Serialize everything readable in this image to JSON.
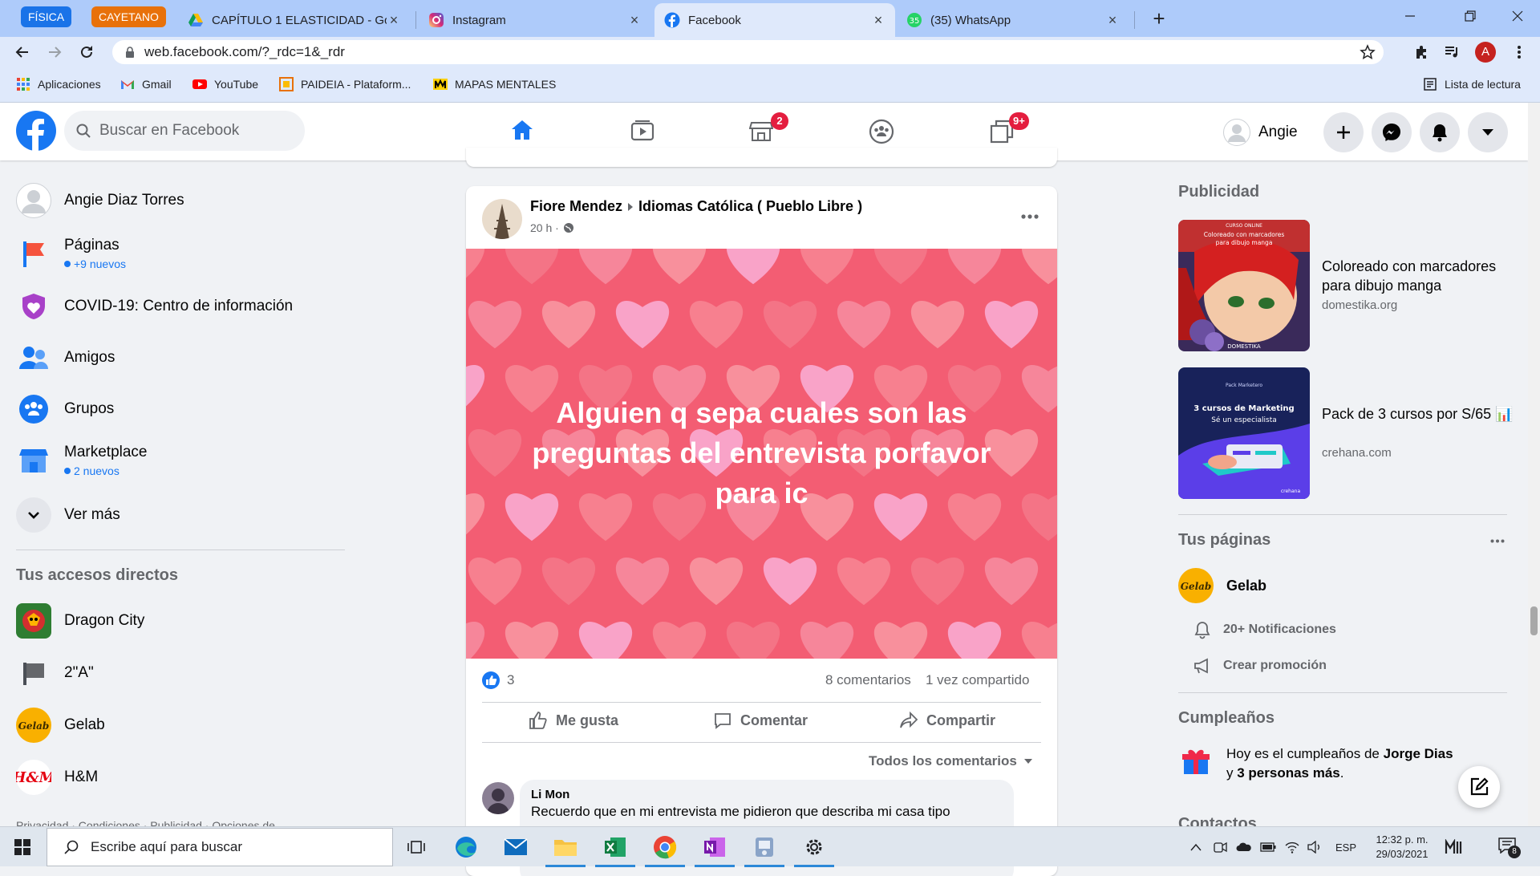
{
  "browser": {
    "tab_groups": [
      {
        "label": "FÍSICA",
        "color": "#1a73e8"
      },
      {
        "label": "CAYETANO",
        "color": "#e8710a"
      }
    ],
    "tabs": [
      {
        "title": "CAPÍTULO 1 ELASTICIDAD - Goo",
        "icon": "google-drive-icon",
        "active": false
      },
      {
        "title": "Instagram",
        "icon": "instagram-icon",
        "active": false
      },
      {
        "title": "Facebook",
        "icon": "facebook-icon",
        "active": true
      },
      {
        "title": "(35) WhatsApp",
        "icon": "whatsapp-icon",
        "active": false
      }
    ],
    "new_tab": "+",
    "url": "web.facebook.com/?_rdc=1&_rdr",
    "profile_initial": "A",
    "bookmarks": [
      {
        "label": "Aplicaciones",
        "icon": "apps-grid-icon"
      },
      {
        "label": "Gmail",
        "icon": "gmail-icon"
      },
      {
        "label": "YouTube",
        "icon": "youtube-icon"
      },
      {
        "label": "PAIDEIA - Plataform...",
        "icon": "paideia-icon"
      },
      {
        "label": "MAPAS MENTALES",
        "icon": "mapas-icon"
      }
    ],
    "reading_list": "Lista de lectura"
  },
  "fb": {
    "brand_color": "#1877f2",
    "search_placeholder": "Buscar en Facebook",
    "nav_badges": {
      "marketplace": "2",
      "gaming": "9+"
    },
    "profile_name": "Angie",
    "left_menu": [
      {
        "label": "Angie Diaz Torres",
        "icon": "avatar-icon"
      },
      {
        "label": "Páginas",
        "sub": "+9 nuevos",
        "icon": "pages-flag-icon"
      },
      {
        "label": "COVID-19: Centro de información",
        "icon": "covid-heart-icon"
      },
      {
        "label": "Amigos",
        "icon": "friends-icon"
      },
      {
        "label": "Grupos",
        "icon": "groups-icon"
      },
      {
        "label": "Marketplace",
        "sub": "2 nuevos",
        "icon": "marketplace-icon"
      },
      {
        "label": "Ver más",
        "icon": "chevron-down-icon"
      }
    ],
    "shortcuts_title": "Tus accesos directos",
    "shortcuts": [
      {
        "label": "Dragon City",
        "icon": "dragon-city-icon"
      },
      {
        "label": "2\"A\"",
        "icon": "flag-icon"
      },
      {
        "label": "Gelab",
        "icon": "gelab-icon"
      },
      {
        "label": "H&M",
        "icon": "hm-icon"
      }
    ],
    "footer_links": "Privacidad · Condiciones · Publicidad · Opciones de",
    "post": {
      "author": "Fiore Mendez",
      "group": "Idiomas Católica ( Pueblo Libre )",
      "time": "20 h ·",
      "text": "Alguien q sepa cuales son las preguntas del entrevista porfavor para ic",
      "likes": "3",
      "comments": "8 comentarios",
      "shares": "1 vez compartido",
      "actions": {
        "like": "Me gusta",
        "comment": "Comentar",
        "share": "Compartir"
      },
      "comment_filter": "Todos los comentarios",
      "first_comment": {
        "author": "Li Mon",
        "text": "Recuerdo que en mi entrevista me pidieron que describa mi casa tipo"
      }
    },
    "right": {
      "ads_title": "Publicidad",
      "ads": [
        {
          "title": "Coloreado con marcadores para dibujo manga",
          "source": "domestika.org",
          "img_lines": [
            "CURSO ONLINE",
            "Coloreado con marcadores",
            "para dibujo manga",
            "DOMESTIKA"
          ]
        },
        {
          "title": "Pack de 3 cursos por S/65 📊",
          "source": "crehana.com",
          "img_lines": [
            "Pack Marketero",
            "3 cursos de Marketing",
            "Sé un especialista",
            "crehana"
          ]
        }
      ],
      "pages_title": "Tus páginas",
      "page_name": "Gelab",
      "page_notifications": "20+ Notificaciones",
      "page_promo": "Crear promoción",
      "birthdays_title": "Cumpleaños",
      "birthday_pre": "Hoy es el cumpleaños de ",
      "birthday_name": "Jorge Dias",
      "birthday_mid": " y",
      "birthday_others": "3 personas más",
      "birthday_end": ".",
      "contacts_title": "Contactos"
    }
  },
  "taskbar": {
    "search_placeholder": "Escribe aquí para buscar",
    "apps": [
      "task-view-icon",
      "edge-icon",
      "mail-icon",
      "file-explorer-icon",
      "excel-icon",
      "chrome-icon",
      "onenote-icon",
      "app-icon",
      "settings-icon"
    ],
    "language": "ESP",
    "time": "12:32 p. m.",
    "date": "29/03/2021",
    "notification_count": "8"
  }
}
